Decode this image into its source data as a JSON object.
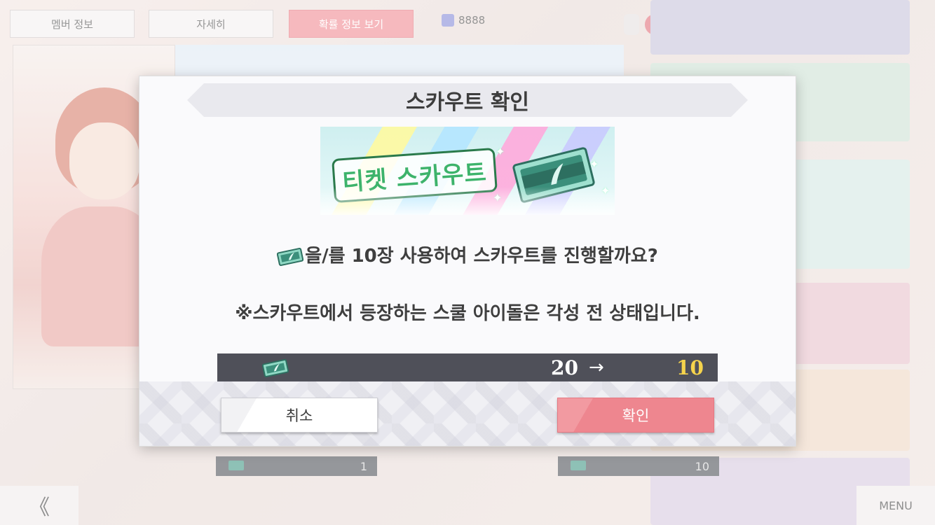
{
  "background": {
    "tabs": [
      "멤버 정보",
      "자세히",
      "확률 정보 보기"
    ],
    "currency_value": "8888",
    "left_ticket_count": "1",
    "right_ticket_count": "10",
    "back_label": "《",
    "menu_label": "MENU"
  },
  "dialog": {
    "title": "스카우트 확인",
    "banner_logo": "티켓 스카우트",
    "message_ticket_icon": "ticket-icon",
    "message_prefix": "을/를 10장 사용하여 스카우트를 진행할까요?",
    "note": "※스카우트에서 등장하는 스쿨 아이돌은 각성 전 상태입니다.",
    "count_before": "20",
    "count_arrow": "→",
    "count_after": "10",
    "cancel_label": "취소",
    "confirm_label": "확인"
  },
  "colors": {
    "accent_pink": "#ee868f",
    "count_after": "#f5d34c",
    "bar_bg": "#4f5059"
  }
}
